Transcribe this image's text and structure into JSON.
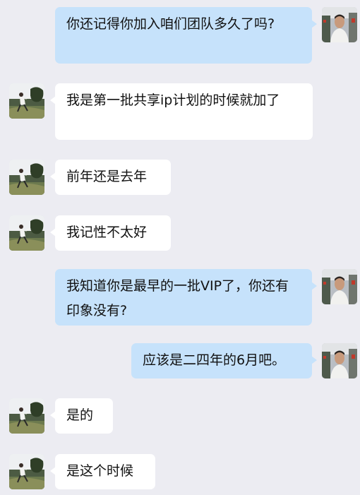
{
  "chat": {
    "messages": [
      {
        "sender": "me",
        "text": "你还记得你加入咱们团队多久了吗?"
      },
      {
        "sender": "other",
        "text": "我是第一批共享ip计划的时候就加了"
      },
      {
        "sender": "other",
        "text": "前年还是去年"
      },
      {
        "sender": "other",
        "text": "我记性不太好"
      },
      {
        "sender": "me",
        "text": "我知道你是最早的一批VIP了，你还有印象没有?"
      },
      {
        "sender": "me",
        "text": "应该是二四年的6月吧。"
      },
      {
        "sender": "other",
        "text": "是的"
      },
      {
        "sender": "other",
        "text": "是这个时候"
      }
    ]
  },
  "colors": {
    "background": "#ececf2",
    "my_bubble": "#c6e2fb",
    "their_bubble": "#ffffff"
  },
  "icons": {
    "me_avatar": "person-photo-avatar",
    "other_avatar": "outdoor-scene-photo-avatar"
  }
}
